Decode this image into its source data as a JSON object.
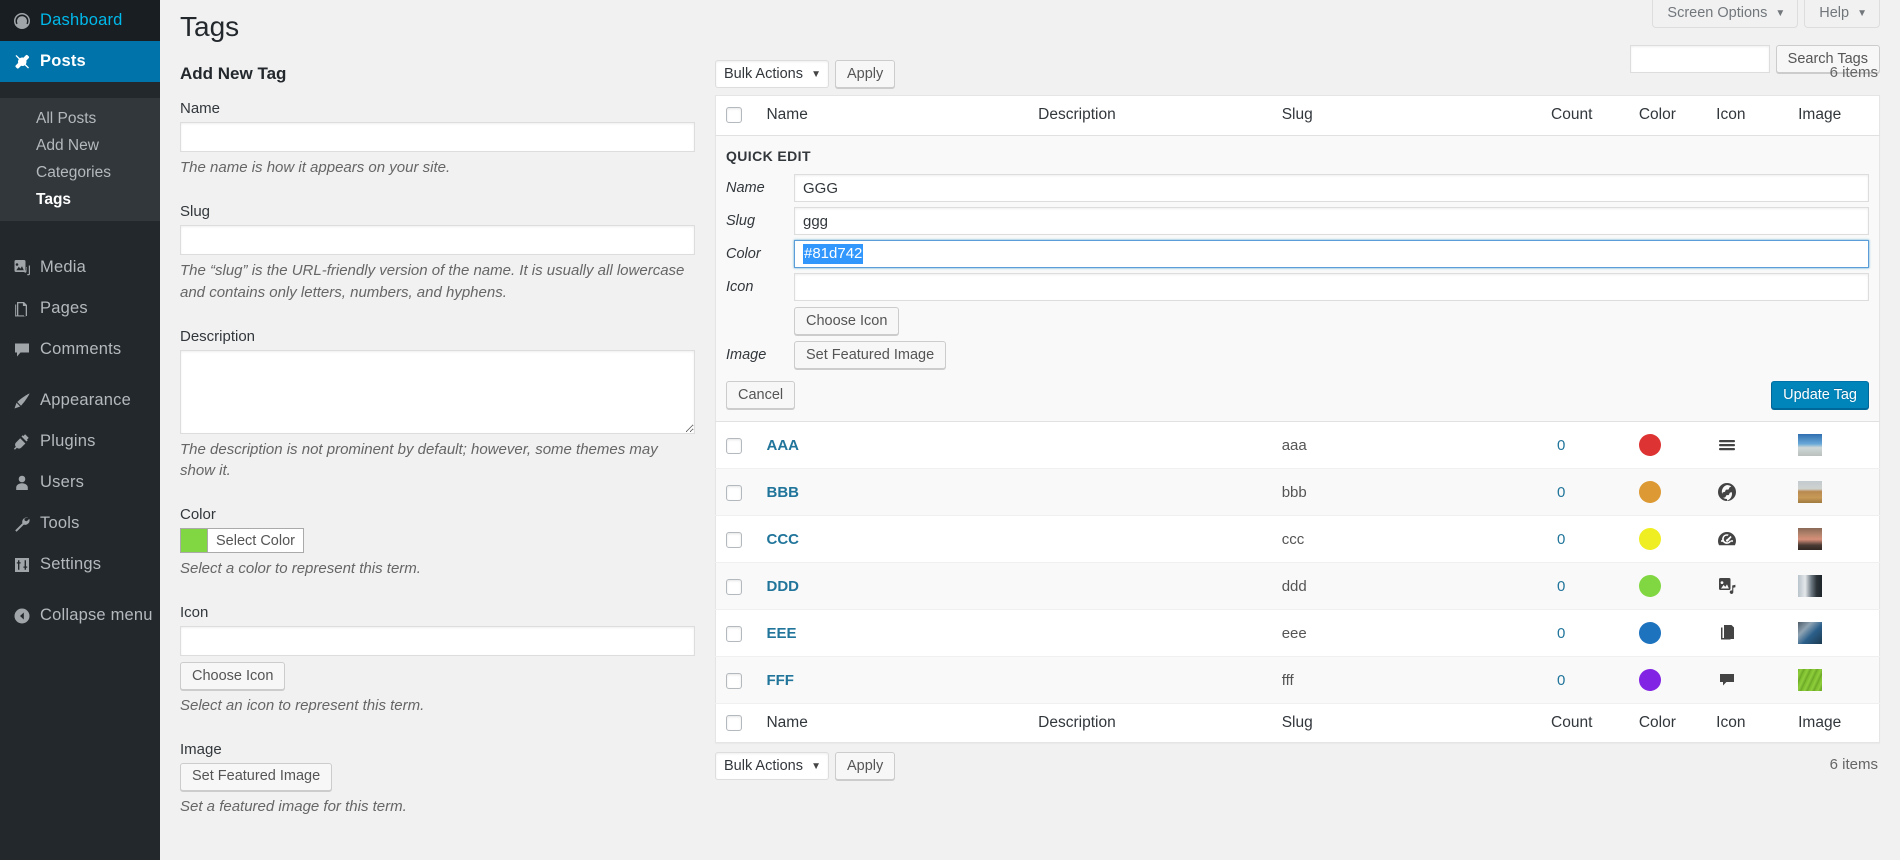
{
  "sidebar": {
    "items": [
      {
        "label": "Dashboard",
        "icon": "dashboard-icon",
        "current": false
      },
      {
        "label": "Posts",
        "icon": "posts-pin-icon",
        "current": true
      },
      {
        "label": "Media",
        "icon": "media-icon",
        "current": false
      },
      {
        "label": "Pages",
        "icon": "pages-icon",
        "current": false
      },
      {
        "label": "Comments",
        "icon": "comments-icon",
        "current": false
      },
      {
        "label": "Appearance",
        "icon": "appearance-brush-icon",
        "current": false
      },
      {
        "label": "Plugins",
        "icon": "plugins-plug-icon",
        "current": false
      },
      {
        "label": "Users",
        "icon": "users-icon",
        "current": false
      },
      {
        "label": "Tools",
        "icon": "tools-wrench-icon",
        "current": false
      },
      {
        "label": "Settings",
        "icon": "settings-sliders-icon",
        "current": false
      },
      {
        "label": "Collapse menu",
        "icon": "collapse-arrow-icon",
        "current": false
      }
    ],
    "submenu": [
      {
        "label": "All Posts",
        "current": false
      },
      {
        "label": "Add New",
        "current": false
      },
      {
        "label": "Categories",
        "current": false
      },
      {
        "label": "Tags",
        "current": true
      }
    ]
  },
  "header": {
    "title": "Tags",
    "screen_options": "Screen Options",
    "help": "Help",
    "caret": "▼"
  },
  "search": {
    "value": "",
    "placeholder": "",
    "button": "Search Tags"
  },
  "add_form": {
    "heading": "Add New Tag",
    "name_label": "Name",
    "name_value": "",
    "name_help": "The name is how it appears on your site.",
    "slug_label": "Slug",
    "slug_value": "",
    "slug_help": "The “slug” is the URL-friendly version of the name. It is usually all lowercase and contains only letters, numbers, and hyphens.",
    "description_label": "Description",
    "description_value": "",
    "description_help": "The description is not prominent by default; however, some themes may show it.",
    "color_label": "Color",
    "color_button": "Select Color",
    "color_swatch": "#81d742",
    "color_help": "Select a color to represent this term.",
    "icon_label": "Icon",
    "icon_value": "",
    "icon_button": "Choose Icon",
    "icon_help": "Select an icon to represent this term.",
    "image_label": "Image",
    "image_button": "Set Featured Image",
    "image_help": "Set a featured image for this term."
  },
  "tablenav": {
    "bulk_label": "Bulk Actions",
    "bulk_caret": "▼",
    "apply": "Apply",
    "items_count": "6 items"
  },
  "table": {
    "columns": {
      "name": "Name",
      "description": "Description",
      "slug": "Slug",
      "count": "Count",
      "color": "Color",
      "icon": "Icon",
      "image": "Image"
    },
    "rows": [
      {
        "name": "AAA",
        "description": "",
        "slug": "aaa",
        "count": "0",
        "color": "#dd3333",
        "icon": "menu-hamburger-icon",
        "image": "trees-sky-thumbnail"
      },
      {
        "name": "BBB",
        "description": "",
        "slug": "bbb",
        "count": "0",
        "color": "#dd9933",
        "icon": "globe-site-icon",
        "image": "desert-landscape-thumbnail"
      },
      {
        "name": "CCC",
        "description": "",
        "slug": "ccc",
        "count": "0",
        "color": "#eeee22",
        "icon": "dashboard-gauge-icon",
        "image": "red-interior-thumbnail"
      },
      {
        "name": "DDD",
        "description": "",
        "slug": "ddd",
        "count": "0",
        "color": "#81d742",
        "icon": "media-photo-music-icon",
        "image": "indoor-scene-thumbnail"
      },
      {
        "name": "EEE",
        "description": "",
        "slug": "eee",
        "count": "0",
        "color": "#1e73be",
        "icon": "pages-copy-icon",
        "image": "workspace-thumbnail"
      },
      {
        "name": "FFF",
        "description": "",
        "slug": "fff",
        "count": "0",
        "color": "#8224e3",
        "icon": "comment-bubble-icon",
        "image": "green-grass-thumbnail"
      }
    ]
  },
  "quick_edit": {
    "legend": "QUICK EDIT",
    "name_label": "Name",
    "name_value": "GGG",
    "slug_label": "Slug",
    "slug_value": "ggg",
    "color_label": "Color",
    "color_value": "#81d742",
    "icon_label": "Icon",
    "icon_value": "",
    "icon_button": "Choose Icon",
    "image_label": "Image",
    "image_button": "Set Featured Image",
    "cancel": "Cancel",
    "update": "Update Tag"
  }
}
